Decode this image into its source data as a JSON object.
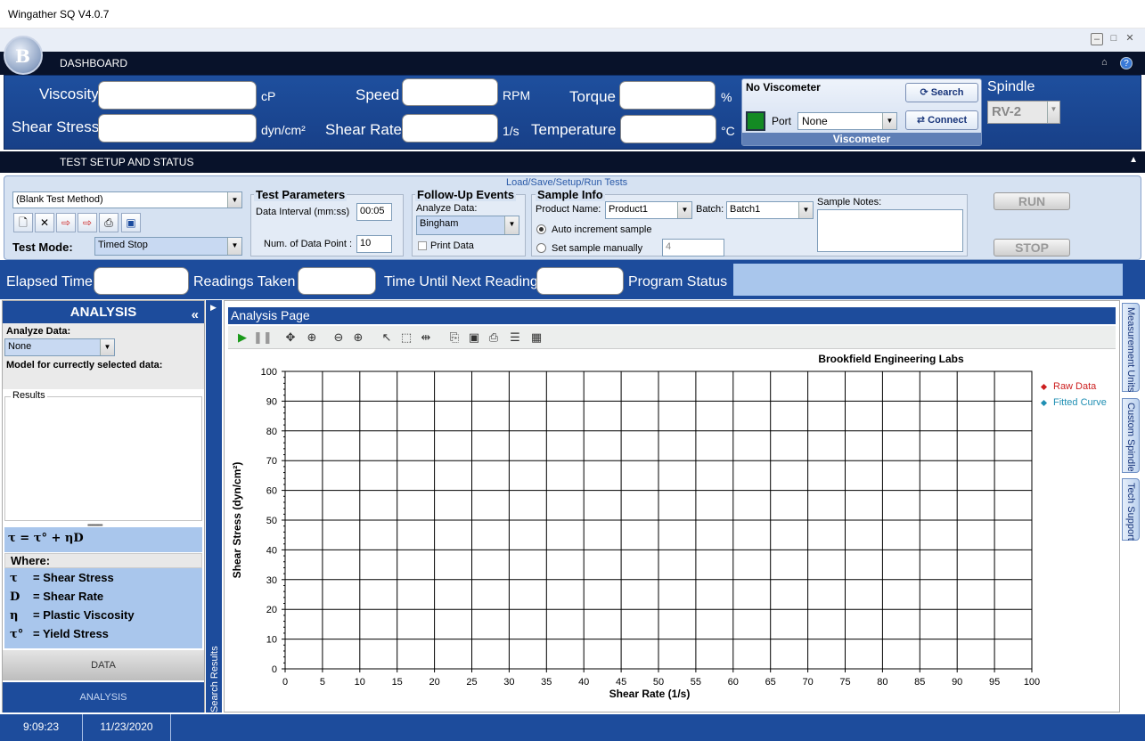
{
  "window": {
    "title": "Wingather SQ V4.0.7"
  },
  "dashboard": {
    "header": "DASHBOARD",
    "viscosity_label": "Viscosity",
    "viscosity_unit": "cP",
    "shear_stress_label": "Shear Stress",
    "shear_stress_unit": "dyn/cm²",
    "speed_label": "Speed",
    "speed_unit": "RPM",
    "shear_rate_label": "Shear Rate",
    "shear_rate_unit": "1/s",
    "torque_label": "Torque",
    "torque_unit": "%",
    "temperature_label": "Temperature",
    "temperature_unit": "°C",
    "viscometer": {
      "status": "No Viscometer",
      "search_label": "Search",
      "connect_label": "Connect",
      "port_label": "Port",
      "port_value": "None",
      "footer": "Viscometer",
      "led_color": "#138a23"
    },
    "spindle_label": "Spindle",
    "spindle_value": "RV-2"
  },
  "setup": {
    "header": "TEST SETUP AND STATUS",
    "link": "Load/Save/Setup/Run Tests",
    "method": "(Blank Test Method)",
    "test_mode_label": "Test Mode:",
    "test_mode_value": "Timed Stop",
    "params_title": "Test Parameters",
    "interval_label": "Data Interval (mm:ss)",
    "interval_value": "00:05",
    "num_points_label": "Num. of Data Point :",
    "num_points_value": "10",
    "followup_title": "Follow-Up Events",
    "analyze_label": "Analyze Data:",
    "analyze_value": "Bingham",
    "print_label": "Print Data",
    "sample_title": "Sample Info",
    "product_label": "Product  Name:",
    "product_value": "Product1",
    "batch_label": "Batch:",
    "batch_value": "Batch1",
    "auto_label": "Auto increment sample",
    "manual_label": "Set sample manually",
    "manual_value": "4",
    "notes_label": "Sample Notes:",
    "run_label": "RUN",
    "stop_label": "STOP"
  },
  "status": {
    "elapsed_label": "Elapsed Time",
    "readings_label": "Readings Taken",
    "next_label": "Time Until Next Reading",
    "program_label": "Program Status"
  },
  "analysis": {
    "header": "ANALYSIS",
    "collapse_icon": "«",
    "analyze_label": "Analyze Data:",
    "analyze_value": "None",
    "model_label": "Model for currectly selected data:",
    "results_label": "Results",
    "formula": "τ = τ° + ηD",
    "where_label": "Where:",
    "legend": [
      {
        "sym": "τ",
        "text": "=  Shear Stress"
      },
      {
        "sym": "D",
        "text": "=  Shear Rate"
      },
      {
        "sym": "η",
        "text": "= Plastic Viscosity"
      },
      {
        "sym": "τ°",
        "text": "= Yield Stress"
      }
    ],
    "data_tab": "DATA",
    "analysis_tab": "ANALYSIS",
    "search_results": "Search Results"
  },
  "analysis_page": {
    "title": "Analysis Page"
  },
  "chart_data": {
    "type": "scatter",
    "title": "Brookfield Engineering Labs",
    "xlabel": "Shear Rate (1/s)",
    "ylabel": "Shear Stress (dyn/cm²)",
    "xlim": [
      0,
      100
    ],
    "ylim": [
      0,
      100
    ],
    "x_ticks": [
      0,
      5,
      10,
      15,
      20,
      25,
      30,
      35,
      40,
      45,
      50,
      55,
      60,
      65,
      70,
      75,
      80,
      85,
      90,
      95,
      100
    ],
    "y_ticks": [
      0,
      10,
      20,
      30,
      40,
      50,
      60,
      70,
      80,
      90,
      100
    ],
    "grid": true,
    "legend_position": "right",
    "series": [
      {
        "name": "Raw Data",
        "color": "#cc1f1f",
        "values": []
      },
      {
        "name": "Fitted Curve",
        "color": "#1f8fb3",
        "values": []
      }
    ]
  },
  "right_tabs": [
    "Measurement Units",
    "Custom Spindle",
    "Tech Support"
  ],
  "footer": {
    "time": "9:09:23",
    "date": "11/23/2020"
  }
}
